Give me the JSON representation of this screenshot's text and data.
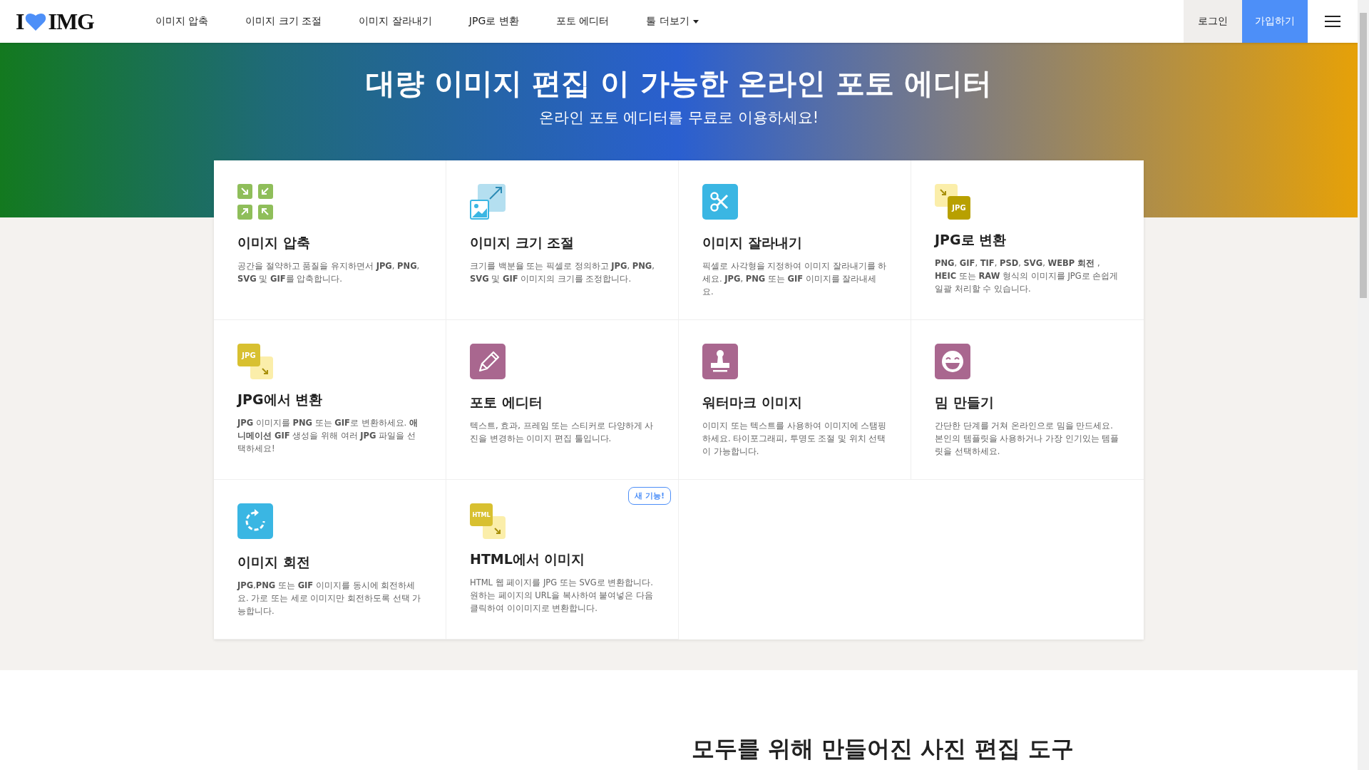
{
  "header": {
    "logo": {
      "left": "I",
      "right": "IMG"
    },
    "nav": [
      {
        "label": "이미지 압축",
        "kind": "link"
      },
      {
        "label": "이미지 크기 조절",
        "kind": "link"
      },
      {
        "label": "이미지 잘라내기",
        "kind": "link"
      },
      {
        "label": "JPG로 변환",
        "kind": "link"
      },
      {
        "label": "포토 에디터",
        "kind": "link"
      },
      {
        "label": "툴 더보기",
        "kind": "dropdown"
      }
    ],
    "login": "로그인",
    "signup": "가입하기"
  },
  "hero": {
    "title": "대량 이미지 편집 이 가능한 온라인 포토 에디터",
    "subtitle": "온라인 포토 에디터를 무료로 이용하세요!"
  },
  "tools": [
    {
      "title": "이미지 압축",
      "description": "공간을 절약하고 품질을 유지하면서 **JPG**, **PNG**, **SVG** 및 **GIF**를 압축합니다.",
      "kind": "compress"
    },
    {
      "title": "이미지 크기 조절",
      "description": "크기를 백분율 또는 픽셀로 정의하고 **JPG**, **PNG**, **SVG** 및 **GIF** 이미지의 크기를 조정합니다.",
      "kind": "resize"
    },
    {
      "title": "이미지 잘라내기",
      "description": "픽셀로 사각형을 지정하여 이미지 잘라내기를 하세요. **JPG**, **PNG** 또는 **GIF** 이미지를 잘라내세요.",
      "kind": "crop"
    },
    {
      "title": "JPG로 변환",
      "description": "**PNG**, **GIF**, **TIF**, **PSD**, **SVG**, **WEBP 회전** , **HEIC** 또는 **RAW** 형식의 이미지를 JPG로 손쉽게 일괄 처리할 수 있습니다.",
      "kind": "to_format",
      "icon_label": "JPG"
    },
    {
      "title": "JPG에서 변환",
      "description": "**JPG** 이미지를 **PNG** 또는 **GIF**로 변환하세요. **애니메이션 GIF** 생성을 위해 여러 **JPG** 파일을 선택하세요!",
      "kind": "from_format",
      "icon_label": "JPG"
    },
    {
      "title": "포토 에디터",
      "description": "텍스트, 효과, 프레임 또는 스티커로 다양하게 사진을 변경하는 이미지 편집 툴입니다.",
      "kind": "pencil"
    },
    {
      "title": "워터마크 이미지",
      "description": "이미지 또는 텍스트를 사용하여 이미지에 스탬핑하세요. 타이포그래피, 투명도 조절 및 위치 선택이 가능합니다.",
      "kind": "stamp"
    },
    {
      "title": "밈 만들기",
      "description": "간단한 단계를 거쳐 온라인으로 밈을 만드세요. 본인의 템플릿을 사용하거나 가장 인기있는 템플릿을 선택하세요.",
      "kind": "laugh"
    },
    {
      "title": "이미지 회전",
      "description": "**JPG**,**PNG** 또는 **GIF** 이미지를 동시에 회전하세요. 가로 또는 세로 이미지만 회전하도록 선택 가능합니다.",
      "kind": "rotate"
    },
    {
      "title": "HTML에서 이미지",
      "description": "HTML 웹 페이지를 JPG 또는 SVG로 변환합니다. 원하는 페이지의 URL을 복사하여 붙여넣은 다음 클릭하여 이이미지로 변환합니다.",
      "kind": "from_format",
      "icon_label": "HTML",
      "badge": "새 기능!"
    }
  ],
  "section": {
    "heading": "모두를 위해 만들어진 사진 편집 도구"
  }
}
